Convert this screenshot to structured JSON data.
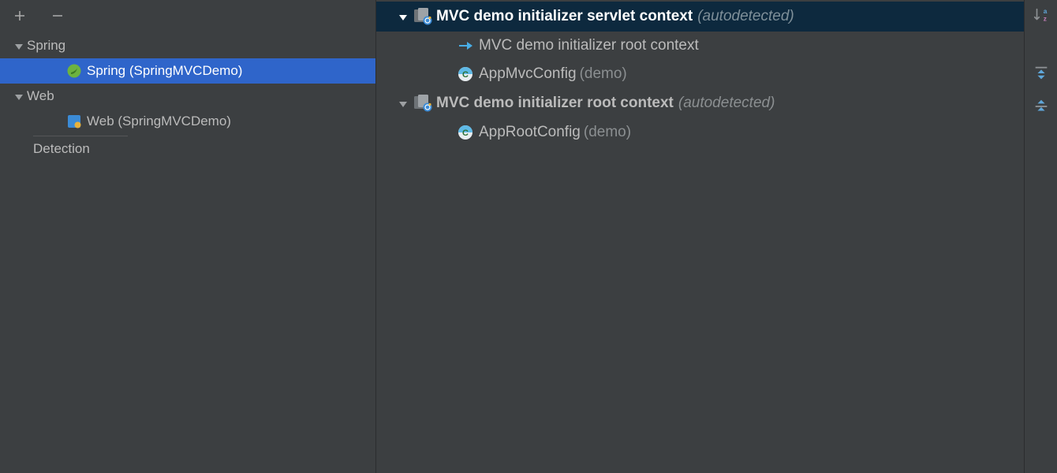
{
  "left": {
    "groups": [
      {
        "label": "Spring",
        "items": [
          {
            "label": "Spring (SpringMVCDemo)",
            "selected": true
          }
        ]
      },
      {
        "label": "Web",
        "items": [
          {
            "label": "Web (SpringMVCDemo)"
          }
        ]
      }
    ],
    "detection_label": "Detection"
  },
  "right": {
    "nodes": [
      {
        "title": "MVC demo initializer servlet context",
        "note": "(autodetected)",
        "selected": true,
        "children": [
          {
            "type": "link",
            "label": "MVC demo initializer root context"
          },
          {
            "type": "config",
            "label": "AppMvcConfig",
            "note": "(demo)"
          }
        ]
      },
      {
        "title": "MVC demo initializer root context",
        "note": "(autodetected)",
        "children": [
          {
            "type": "config",
            "label": "AppRootConfig",
            "note": "(demo)"
          }
        ]
      }
    ]
  }
}
